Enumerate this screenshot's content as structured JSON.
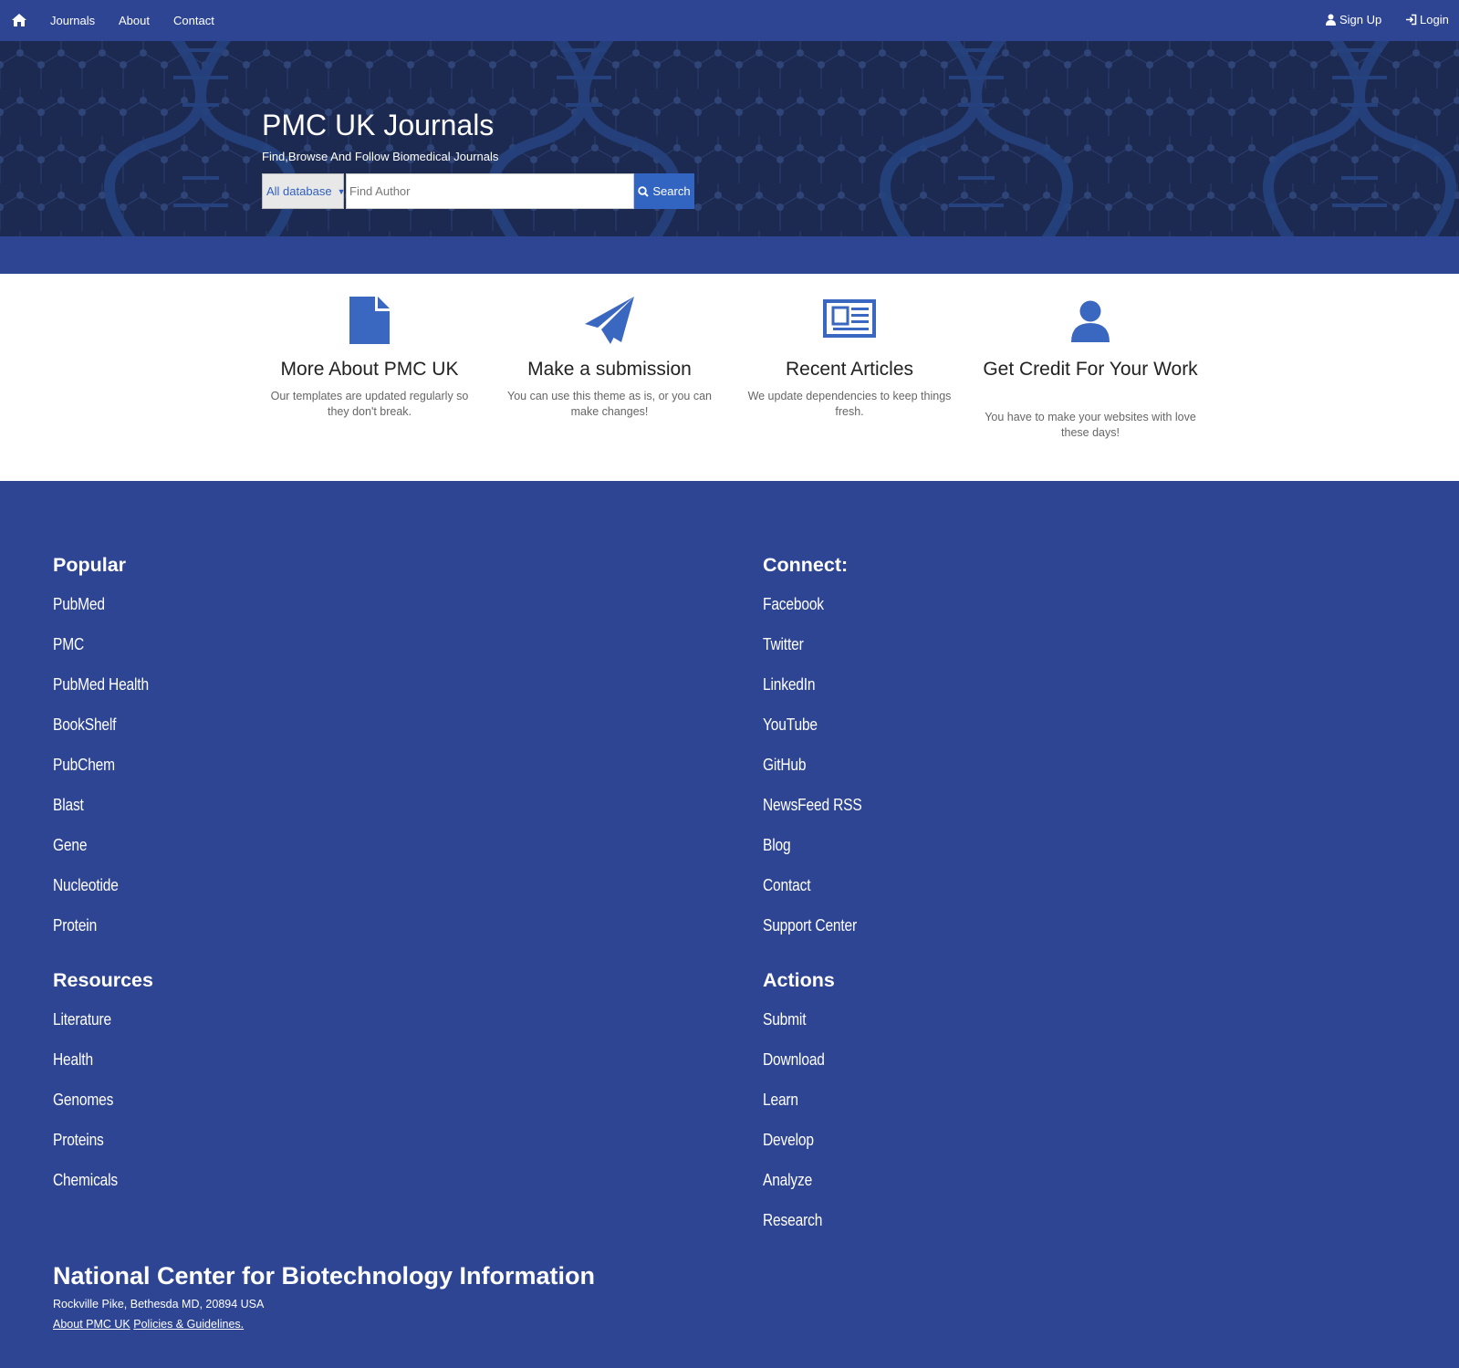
{
  "nav": {
    "items": [
      "Journals",
      "About",
      "Contact"
    ],
    "signup": "Sign Up",
    "login": "Login"
  },
  "hero": {
    "title": "PMC UK Journals",
    "subtitle": "Find,Browse And Follow Biomedical Journals",
    "db_select": "All database",
    "search_placeholder": "Find Author",
    "search_button": "Search"
  },
  "features": [
    {
      "icon": "document-icon",
      "title": "More About PMC UK",
      "text": "Our templates are updated regularly so they don't break."
    },
    {
      "icon": "paper-plane-icon",
      "title": "Make a submission",
      "text": "You can use this theme as is, or you can make changes!"
    },
    {
      "icon": "newspaper-icon",
      "title": "Recent Articles",
      "text": "We update dependencies to keep things fresh."
    },
    {
      "icon": "user-icon",
      "title": "Get Credit For Your Work",
      "text": "You have to make your websites with love these days!"
    }
  ],
  "footer": {
    "popular": {
      "heading": "Popular",
      "links": [
        "PubMed",
        "PMC",
        "PubMed Health",
        "BookShelf",
        "PubChem",
        "Blast",
        "Gene",
        "Nucleotide",
        "Protein"
      ]
    },
    "connect": {
      "heading": "Connect:",
      "links": [
        "Facebook",
        "Twitter",
        "LinkedIn",
        "YouTube",
        "GitHub",
        "NewsFeed RSS",
        "Blog",
        "Contact",
        "Support Center"
      ]
    },
    "resources": {
      "heading": "Resources",
      "links": [
        "Literature",
        "Health",
        "Genomes",
        "Proteins",
        "Chemicals"
      ]
    },
    "actions": {
      "heading": "Actions",
      "links": [
        "Submit",
        "Download",
        "Learn",
        "Develop",
        "Analyze",
        "Research"
      ]
    },
    "org_name": "National Center for Biotechnology Information",
    "address": "Rockville Pike, Bethesda MD, 20894 USA",
    "about_link": "About PMC UK",
    "policies_link": "Policies & Guidelines."
  },
  "colors": {
    "primary": "#2e4593",
    "hero_bg": "#1c2a52",
    "accent": "#3264c2"
  }
}
